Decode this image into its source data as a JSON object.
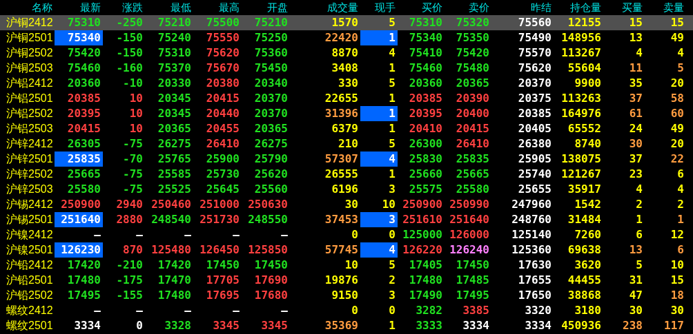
{
  "columns": [
    "名称",
    "最新",
    "涨跌",
    "最低",
    "最高",
    "开盘",
    "成交量",
    "现手",
    "买价",
    "卖价",
    "昨结",
    "持仓量",
    "买量",
    "卖量"
  ],
  "rows": [
    {
      "name": "沪铜2412",
      "selected": true,
      "last_flash": false,
      "hand_flash": false,
      "cells": [
        {
          "text": "75310",
          "color": "#20e020"
        },
        {
          "text": "-250",
          "color": "#20e020"
        },
        {
          "text": "75210",
          "color": "#20e020"
        },
        {
          "text": "75500",
          "color": "#20e020"
        },
        {
          "text": "75210",
          "color": "#20e020"
        },
        {
          "text": "1570",
          "color": "#ffff00"
        },
        {
          "text": "5",
          "color": "#ffff00"
        },
        {
          "text": "75310",
          "color": "#20e020"
        },
        {
          "text": "75320",
          "color": "#20e020"
        },
        {
          "text": "75560",
          "color": "#ffffff"
        },
        {
          "text": "12155",
          "color": "#ffff00"
        },
        {
          "text": "15",
          "color": "#ffff00"
        },
        {
          "text": "15",
          "color": "#ffff00"
        }
      ]
    },
    {
      "name": "沪铜2501",
      "selected": false,
      "last_flash": true,
      "hand_flash": true,
      "cells": [
        {
          "text": "75340",
          "color": "#ffffff"
        },
        {
          "text": "-150",
          "color": "#20e020"
        },
        {
          "text": "75240",
          "color": "#20e020"
        },
        {
          "text": "75550",
          "color": "#ff4040"
        },
        {
          "text": "75250",
          "color": "#20e020"
        },
        {
          "text": "22420",
          "color": "#ff9c40"
        },
        {
          "text": "1",
          "color": "#ffffff"
        },
        {
          "text": "75340",
          "color": "#20e020"
        },
        {
          "text": "75350",
          "color": "#20e020"
        },
        {
          "text": "75490",
          "color": "#ffffff"
        },
        {
          "text": "148956",
          "color": "#ffff00"
        },
        {
          "text": "13",
          "color": "#ffff00"
        },
        {
          "text": "49",
          "color": "#ffff00"
        }
      ]
    },
    {
      "name": "沪铜2502",
      "selected": false,
      "last_flash": false,
      "hand_flash": false,
      "cells": [
        {
          "text": "75420",
          "color": "#20e020"
        },
        {
          "text": "-150",
          "color": "#20e020"
        },
        {
          "text": "75310",
          "color": "#20e020"
        },
        {
          "text": "75620",
          "color": "#ff4040"
        },
        {
          "text": "75360",
          "color": "#20e020"
        },
        {
          "text": "8870",
          "color": "#ffff00"
        },
        {
          "text": "4",
          "color": "#ffff00"
        },
        {
          "text": "75410",
          "color": "#20e020"
        },
        {
          "text": "75420",
          "color": "#20e020"
        },
        {
          "text": "75570",
          "color": "#ffffff"
        },
        {
          "text": "113267",
          "color": "#ffff00"
        },
        {
          "text": "4",
          "color": "#ffff00"
        },
        {
          "text": "4",
          "color": "#ffff00"
        }
      ]
    },
    {
      "name": "沪铜2503",
      "selected": false,
      "last_flash": false,
      "hand_flash": false,
      "cells": [
        {
          "text": "75460",
          "color": "#20e020"
        },
        {
          "text": "-160",
          "color": "#20e020"
        },
        {
          "text": "75370",
          "color": "#20e020"
        },
        {
          "text": "75670",
          "color": "#ff4040"
        },
        {
          "text": "75450",
          "color": "#20e020"
        },
        {
          "text": "3408",
          "color": "#ffff00"
        },
        {
          "text": "1",
          "color": "#ffff00"
        },
        {
          "text": "75460",
          "color": "#20e020"
        },
        {
          "text": "75480",
          "color": "#20e020"
        },
        {
          "text": "75620",
          "color": "#ffffff"
        },
        {
          "text": "55604",
          "color": "#ffff00"
        },
        {
          "text": "11",
          "color": "#ff9c40"
        },
        {
          "text": "5",
          "color": "#ff9c40"
        }
      ]
    },
    {
      "name": "沪铝2412",
      "selected": false,
      "last_flash": false,
      "hand_flash": false,
      "cells": [
        {
          "text": "20360",
          "color": "#20e020"
        },
        {
          "text": "-10",
          "color": "#20e020"
        },
        {
          "text": "20330",
          "color": "#20e020"
        },
        {
          "text": "20380",
          "color": "#ff4040"
        },
        {
          "text": "20340",
          "color": "#20e020"
        },
        {
          "text": "330",
          "color": "#ffff00"
        },
        {
          "text": "5",
          "color": "#ffff00"
        },
        {
          "text": "20360",
          "color": "#20e020"
        },
        {
          "text": "20365",
          "color": "#20e020"
        },
        {
          "text": "20370",
          "color": "#ffffff"
        },
        {
          "text": "9900",
          "color": "#ffff00"
        },
        {
          "text": "35",
          "color": "#ffff00"
        },
        {
          "text": "20",
          "color": "#ffff00"
        }
      ]
    },
    {
      "name": "沪铝2501",
      "selected": false,
      "last_flash": false,
      "hand_flash": false,
      "cells": [
        {
          "text": "20385",
          "color": "#ff4040"
        },
        {
          "text": "10",
          "color": "#ff4040"
        },
        {
          "text": "20345",
          "color": "#20e020"
        },
        {
          "text": "20415",
          "color": "#ff4040"
        },
        {
          "text": "20370",
          "color": "#20e020"
        },
        {
          "text": "22655",
          "color": "#ffff00"
        },
        {
          "text": "1",
          "color": "#ffff00"
        },
        {
          "text": "20385",
          "color": "#ff4040"
        },
        {
          "text": "20390",
          "color": "#ff4040"
        },
        {
          "text": "20375",
          "color": "#ffffff"
        },
        {
          "text": "113263",
          "color": "#ffff00"
        },
        {
          "text": "37",
          "color": "#ff9c40"
        },
        {
          "text": "58",
          "color": "#ff9c40"
        }
      ]
    },
    {
      "name": "沪铝2502",
      "selected": false,
      "last_flash": false,
      "hand_flash": true,
      "cells": [
        {
          "text": "20395",
          "color": "#ff4040"
        },
        {
          "text": "10",
          "color": "#ff4040"
        },
        {
          "text": "20345",
          "color": "#20e020"
        },
        {
          "text": "20440",
          "color": "#ff4040"
        },
        {
          "text": "20370",
          "color": "#20e020"
        },
        {
          "text": "31396",
          "color": "#ff9c40"
        },
        {
          "text": "1",
          "color": "#ffffff"
        },
        {
          "text": "20395",
          "color": "#ff4040"
        },
        {
          "text": "20400",
          "color": "#ff4040"
        },
        {
          "text": "20385",
          "color": "#ffffff"
        },
        {
          "text": "164976",
          "color": "#ffff00"
        },
        {
          "text": "61",
          "color": "#ff9c40"
        },
        {
          "text": "60",
          "color": "#ff9c40"
        }
      ]
    },
    {
      "name": "沪铝2503",
      "selected": false,
      "last_flash": false,
      "hand_flash": false,
      "cells": [
        {
          "text": "20415",
          "color": "#ff4040"
        },
        {
          "text": "10",
          "color": "#ff4040"
        },
        {
          "text": "20365",
          "color": "#20e020"
        },
        {
          "text": "20455",
          "color": "#ff4040"
        },
        {
          "text": "20365",
          "color": "#20e020"
        },
        {
          "text": "6379",
          "color": "#ffff00"
        },
        {
          "text": "1",
          "color": "#ffff00"
        },
        {
          "text": "20410",
          "color": "#ff4040"
        },
        {
          "text": "20415",
          "color": "#ff4040"
        },
        {
          "text": "20405",
          "color": "#ffffff"
        },
        {
          "text": "65552",
          "color": "#ffff00"
        },
        {
          "text": "24",
          "color": "#ffff00"
        },
        {
          "text": "49",
          "color": "#ffff00"
        }
      ]
    },
    {
      "name": "沪锌2412",
      "selected": false,
      "last_flash": false,
      "hand_flash": false,
      "cells": [
        {
          "text": "26305",
          "color": "#20e020"
        },
        {
          "text": "-75",
          "color": "#20e020"
        },
        {
          "text": "26275",
          "color": "#20e020"
        },
        {
          "text": "26410",
          "color": "#ff4040"
        },
        {
          "text": "26275",
          "color": "#20e020"
        },
        {
          "text": "210",
          "color": "#ffff00"
        },
        {
          "text": "5",
          "color": "#ffff00"
        },
        {
          "text": "26300",
          "color": "#20e020"
        },
        {
          "text": "26410",
          "color": "#ff4040"
        },
        {
          "text": "26380",
          "color": "#ffffff"
        },
        {
          "text": "8740",
          "color": "#ffff00"
        },
        {
          "text": "30",
          "color": "#ff9c40"
        },
        {
          "text": "20",
          "color": "#ffff00"
        }
      ]
    },
    {
      "name": "沪锌2501",
      "selected": false,
      "last_flash": true,
      "hand_flash": true,
      "cells": [
        {
          "text": "25835",
          "color": "#ffffff"
        },
        {
          "text": "-70",
          "color": "#20e020"
        },
        {
          "text": "25765",
          "color": "#20e020"
        },
        {
          "text": "25900",
          "color": "#20e020"
        },
        {
          "text": "25790",
          "color": "#20e020"
        },
        {
          "text": "57307",
          "color": "#ff9c40"
        },
        {
          "text": "4",
          "color": "#ffffff"
        },
        {
          "text": "25830",
          "color": "#20e020"
        },
        {
          "text": "25835",
          "color": "#20e020"
        },
        {
          "text": "25905",
          "color": "#ffffff"
        },
        {
          "text": "138075",
          "color": "#ffff00"
        },
        {
          "text": "37",
          "color": "#ffff00"
        },
        {
          "text": "22",
          "color": "#ff9c40"
        }
      ]
    },
    {
      "name": "沪锌2502",
      "selected": false,
      "last_flash": false,
      "hand_flash": false,
      "cells": [
        {
          "text": "25665",
          "color": "#20e020"
        },
        {
          "text": "-75",
          "color": "#20e020"
        },
        {
          "text": "25585",
          "color": "#20e020"
        },
        {
          "text": "25730",
          "color": "#20e020"
        },
        {
          "text": "25620",
          "color": "#20e020"
        },
        {
          "text": "26555",
          "color": "#ffff00"
        },
        {
          "text": "1",
          "color": "#ffff00"
        },
        {
          "text": "25660",
          "color": "#20e020"
        },
        {
          "text": "25665",
          "color": "#20e020"
        },
        {
          "text": "25740",
          "color": "#ffffff"
        },
        {
          "text": "121267",
          "color": "#ffff00"
        },
        {
          "text": "23",
          "color": "#ffff00"
        },
        {
          "text": "6",
          "color": "#ffff00"
        }
      ]
    },
    {
      "name": "沪锌2503",
      "selected": false,
      "last_flash": false,
      "hand_flash": false,
      "cells": [
        {
          "text": "25580",
          "color": "#20e020"
        },
        {
          "text": "-75",
          "color": "#20e020"
        },
        {
          "text": "25525",
          "color": "#20e020"
        },
        {
          "text": "25645",
          "color": "#20e020"
        },
        {
          "text": "25560",
          "color": "#20e020"
        },
        {
          "text": "6196",
          "color": "#ffff00"
        },
        {
          "text": "3",
          "color": "#ffff00"
        },
        {
          "text": "25575",
          "color": "#20e020"
        },
        {
          "text": "25580",
          "color": "#20e020"
        },
        {
          "text": "25655",
          "color": "#ffffff"
        },
        {
          "text": "35917",
          "color": "#ffff00"
        },
        {
          "text": "4",
          "color": "#ffff00"
        },
        {
          "text": "4",
          "color": "#ffff00"
        }
      ]
    },
    {
      "name": "沪锡2412",
      "selected": false,
      "last_flash": false,
      "hand_flash": false,
      "cells": [
        {
          "text": "250900",
          "color": "#ff4040"
        },
        {
          "text": "2940",
          "color": "#ff4040"
        },
        {
          "text": "250460",
          "color": "#ff4040"
        },
        {
          "text": "251000",
          "color": "#ff4040"
        },
        {
          "text": "250630",
          "color": "#ff4040"
        },
        {
          "text": "30",
          "color": "#ffff00"
        },
        {
          "text": "10",
          "color": "#ffff00"
        },
        {
          "text": "250900",
          "color": "#ff4040"
        },
        {
          "text": "250990",
          "color": "#ff4040"
        },
        {
          "text": "247960",
          "color": "#ffffff"
        },
        {
          "text": "1542",
          "color": "#ffff00"
        },
        {
          "text": "2",
          "color": "#ffff00"
        },
        {
          "text": "2",
          "color": "#ffff00"
        }
      ]
    },
    {
      "name": "沪锡2501",
      "selected": false,
      "last_flash": true,
      "hand_flash": true,
      "cells": [
        {
          "text": "251640",
          "color": "#ffffff"
        },
        {
          "text": "2880",
          "color": "#ff4040"
        },
        {
          "text": "248540",
          "color": "#20e020"
        },
        {
          "text": "251730",
          "color": "#ff4040"
        },
        {
          "text": "248550",
          "color": "#20e020"
        },
        {
          "text": "37453",
          "color": "#ff9c40"
        },
        {
          "text": "3",
          "color": "#ffffff"
        },
        {
          "text": "251610",
          "color": "#ff4040"
        },
        {
          "text": "251640",
          "color": "#ff4040"
        },
        {
          "text": "248760",
          "color": "#ffffff"
        },
        {
          "text": "31484",
          "color": "#ffff00"
        },
        {
          "text": "1",
          "color": "#ffff00"
        },
        {
          "text": "1",
          "color": "#ff9c40"
        }
      ]
    },
    {
      "name": "沪镍2412",
      "selected": false,
      "last_flash": false,
      "hand_flash": false,
      "cells": [
        {
          "text": "—",
          "color": "#ffffff"
        },
        {
          "text": "—",
          "color": "#ffffff"
        },
        {
          "text": "—",
          "color": "#ffffff"
        },
        {
          "text": "—",
          "color": "#ffffff"
        },
        {
          "text": "—",
          "color": "#ffffff"
        },
        {
          "text": "0",
          "color": "#ffff00"
        },
        {
          "text": "0",
          "color": "#ffff00"
        },
        {
          "text": "125000",
          "color": "#20e020"
        },
        {
          "text": "126000",
          "color": "#ff4040"
        },
        {
          "text": "125140",
          "color": "#ffffff"
        },
        {
          "text": "7260",
          "color": "#ffff00"
        },
        {
          "text": "6",
          "color": "#ffff00"
        },
        {
          "text": "12",
          "color": "#ffff00"
        }
      ]
    },
    {
      "name": "沪镍2501",
      "selected": false,
      "last_flash": true,
      "hand_flash": true,
      "cells": [
        {
          "text": "126230",
          "color": "#ffffff"
        },
        {
          "text": "870",
          "color": "#ff4040"
        },
        {
          "text": "125480",
          "color": "#ff4040"
        },
        {
          "text": "126450",
          "color": "#ff4040"
        },
        {
          "text": "125850",
          "color": "#ff4040"
        },
        {
          "text": "57745",
          "color": "#ff9c40"
        },
        {
          "text": "4",
          "color": "#ffffff"
        },
        {
          "text": "126220",
          "color": "#ff4040"
        },
        {
          "text": "126240",
          "color": "#ff80ff"
        },
        {
          "text": "125360",
          "color": "#ffffff"
        },
        {
          "text": "69638",
          "color": "#ffff00"
        },
        {
          "text": "13",
          "color": "#ff9c40"
        },
        {
          "text": "6",
          "color": "#ff9c40"
        }
      ]
    },
    {
      "name": "沪铅2412",
      "selected": false,
      "last_flash": false,
      "hand_flash": false,
      "cells": [
        {
          "text": "17420",
          "color": "#20e020"
        },
        {
          "text": "-210",
          "color": "#20e020"
        },
        {
          "text": "17420",
          "color": "#20e020"
        },
        {
          "text": "17450",
          "color": "#20e020"
        },
        {
          "text": "17450",
          "color": "#20e020"
        },
        {
          "text": "10",
          "color": "#ffff00"
        },
        {
          "text": "5",
          "color": "#ffff00"
        },
        {
          "text": "17405",
          "color": "#20e020"
        },
        {
          "text": "17450",
          "color": "#20e020"
        },
        {
          "text": "17630",
          "color": "#ffffff"
        },
        {
          "text": "3620",
          "color": "#ffff00"
        },
        {
          "text": "5",
          "color": "#ffff00"
        },
        {
          "text": "10",
          "color": "#ffff00"
        }
      ]
    },
    {
      "name": "沪铅2501",
      "selected": false,
      "last_flash": false,
      "hand_flash": false,
      "cells": [
        {
          "text": "17480",
          "color": "#20e020"
        },
        {
          "text": "-175",
          "color": "#20e020"
        },
        {
          "text": "17470",
          "color": "#20e020"
        },
        {
          "text": "17705",
          "color": "#ff4040"
        },
        {
          "text": "17690",
          "color": "#ff4040"
        },
        {
          "text": "19876",
          "color": "#ffff00"
        },
        {
          "text": "2",
          "color": "#ffff00"
        },
        {
          "text": "17480",
          "color": "#20e020"
        },
        {
          "text": "17485",
          "color": "#20e020"
        },
        {
          "text": "17655",
          "color": "#ffffff"
        },
        {
          "text": "44455",
          "color": "#ffff00"
        },
        {
          "text": "31",
          "color": "#ffff00"
        },
        {
          "text": "15",
          "color": "#ffff00"
        }
      ]
    },
    {
      "name": "沪铅2502",
      "selected": false,
      "last_flash": false,
      "hand_flash": false,
      "cells": [
        {
          "text": "17495",
          "color": "#20e020"
        },
        {
          "text": "-155",
          "color": "#20e020"
        },
        {
          "text": "17480",
          "color": "#20e020"
        },
        {
          "text": "17695",
          "color": "#ff4040"
        },
        {
          "text": "17680",
          "color": "#ff4040"
        },
        {
          "text": "9150",
          "color": "#ffff00"
        },
        {
          "text": "3",
          "color": "#ffff00"
        },
        {
          "text": "17490",
          "color": "#20e020"
        },
        {
          "text": "17495",
          "color": "#20e020"
        },
        {
          "text": "17650",
          "color": "#ffffff"
        },
        {
          "text": "38868",
          "color": "#ffff00"
        },
        {
          "text": "47",
          "color": "#ffff00"
        },
        {
          "text": "18",
          "color": "#ff9c40"
        }
      ]
    },
    {
      "name": "螺纹2412",
      "selected": false,
      "last_flash": false,
      "hand_flash": false,
      "cells": [
        {
          "text": "—",
          "color": "#ffffff"
        },
        {
          "text": "—",
          "color": "#ffffff"
        },
        {
          "text": "—",
          "color": "#ffffff"
        },
        {
          "text": "—",
          "color": "#ffffff"
        },
        {
          "text": "—",
          "color": "#ffffff"
        },
        {
          "text": "0",
          "color": "#ffff00"
        },
        {
          "text": "0",
          "color": "#ffff00"
        },
        {
          "text": "3282",
          "color": "#20e020"
        },
        {
          "text": "3385",
          "color": "#ff4040"
        },
        {
          "text": "3320",
          "color": "#ffffff"
        },
        {
          "text": "3180",
          "color": "#ffff00"
        },
        {
          "text": "30",
          "color": "#ffff00"
        },
        {
          "text": "30",
          "color": "#ffff00"
        }
      ]
    },
    {
      "name": "螺纹2501",
      "selected": false,
      "last_flash": false,
      "hand_flash": false,
      "cells": [
        {
          "text": "3334",
          "color": "#ffffff"
        },
        {
          "text": "0",
          "color": "#ffffff"
        },
        {
          "text": "3328",
          "color": "#20e020"
        },
        {
          "text": "3345",
          "color": "#ff4040"
        },
        {
          "text": "3345",
          "color": "#ff4040"
        },
        {
          "text": "35369",
          "color": "#ff9c40"
        },
        {
          "text": "1",
          "color": "#ffff00"
        },
        {
          "text": "3333",
          "color": "#20e020"
        },
        {
          "text": "3334",
          "color": "#ffffff"
        },
        {
          "text": "3334",
          "color": "#ffffff"
        },
        {
          "text": "450936",
          "color": "#ffff00"
        },
        {
          "text": "238",
          "color": "#ff9c40"
        },
        {
          "text": "117",
          "color": "#ff9c40"
        }
      ]
    }
  ]
}
